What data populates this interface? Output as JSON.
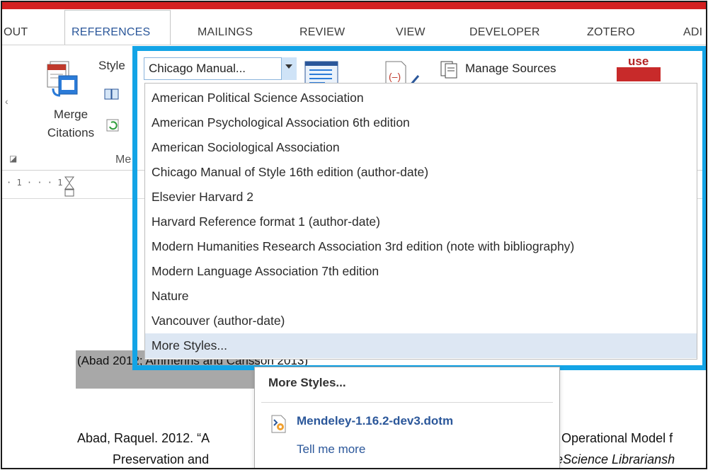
{
  "ribbon_tabs": [
    "OUT",
    "REFERENCES",
    "MAILINGS",
    "REVIEW",
    "VIEW",
    "DEVELOPER",
    "ZOTERO",
    "ADI"
  ],
  "active_tab": "REFERENCES",
  "ribbon": {
    "merge_line1": "Merge",
    "merge_line2": "Citations",
    "style_label": "Style",
    "style_value": "Chicago Manual...",
    "manage_sources": "Manage Sources",
    "group_label": "Me",
    "usen_logo": "use"
  },
  "ruler": {
    "text": "· 1 · · · 1"
  },
  "style_list": [
    "American Political Science Association",
    "American Psychological Association 6th edition",
    "American Sociological Association",
    "Chicago Manual of Style 16th edition (author-date)",
    "Elsevier Harvard 2",
    "Harvard Reference format 1 (author-date)",
    "Modern Humanities Research Association 3rd edition (note with bibliography)",
    "Modern Language Association 7th edition",
    "Nature",
    "Vancouver (author-date)",
    "More Styles..."
  ],
  "document": {
    "citation": "(Abad 2012; Ammerins and Carlsson 2013)",
    "bib_line1": "Abad, Raquel. 2012. “A",
    "bib_line1_end": "Operational Model f",
    "bib_line2": "Preservation and",
    "bib_line2_end": "eScience Librariansh"
  },
  "popup": {
    "title": "More Styles...",
    "file": "Mendeley-1.16.2-dev3.dotm",
    "link": "Tell me more"
  },
  "colors": {
    "highlight_border": "#13a4e6",
    "top_bar": "#d42020",
    "accent": "#2b579a"
  }
}
